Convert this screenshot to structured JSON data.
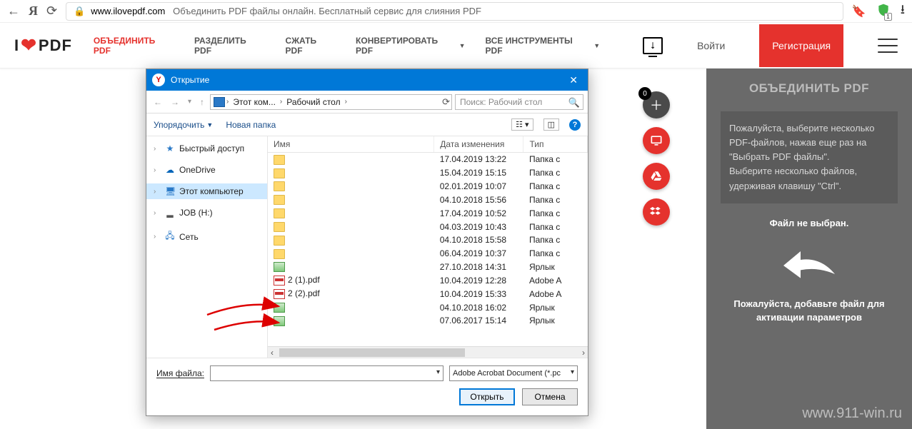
{
  "browser": {
    "url_host": "www.ilovepdf.com",
    "url_title": "Объединить PDF файлы онлайн. Бесплатный сервис для слияния PDF",
    "shield_badge": "1"
  },
  "site": {
    "logo_pre": "I",
    "logo_post": "PDF",
    "nav": {
      "merge": "ОБЪЕДИНИТЬ PDF",
      "split": "РАЗДЕЛИТЬ PDF",
      "compress": "СЖАТЬ PDF",
      "convert": "КОНВЕРТИРОВАТЬ PDF",
      "all": "ВСЕ ИНСТРУМЕНТЫ PDF"
    },
    "login": "Войти",
    "register": "Регистрация"
  },
  "panel": {
    "title": "ОБЪЕДИНИТЬ PDF",
    "help_l1": "Пожалуйста, выберите несколько PDF-файлов, нажав еще раз на \"Выбрать PDF файлы\".",
    "help_l2": "Выберите несколько файлов, удерживая клавишу \"Ctrl\".",
    "status": "Файл не выбран.",
    "msg": "Пожалуйста, добавьте файл для активации параметров",
    "watermark": "www.911-win.ru"
  },
  "bubbles": {
    "count": "0"
  },
  "dialog": {
    "title": "Открытие",
    "path": {
      "pc": "Этот ком...",
      "desk": "Рабочий стол"
    },
    "search_placeholder": "Поиск: Рабочий стол",
    "toolbar": {
      "organize": "Упорядочить",
      "newfolder": "Новая папка"
    },
    "columns": {
      "name": "Имя",
      "date": "Дата изменения",
      "type": "Тип"
    },
    "tree": {
      "quick": "Быстрый доступ",
      "onedrive": "OneDrive",
      "thispc": "Этот компьютер",
      "job": "JOB (H:)",
      "network": "Сеть"
    },
    "rows": [
      {
        "icon": "folder",
        "name": "",
        "date": "17.04.2019 13:22",
        "type": "Папка с"
      },
      {
        "icon": "folder",
        "name": "",
        "date": "15.04.2019 15:15",
        "type": "Папка с"
      },
      {
        "icon": "folder",
        "name": "",
        "date": "02.01.2019 10:07",
        "type": "Папка с"
      },
      {
        "icon": "folder",
        "name": "",
        "date": "04.10.2018 15:56",
        "type": "Папка с"
      },
      {
        "icon": "folder",
        "name": "",
        "date": "17.04.2019 10:52",
        "type": "Папка с"
      },
      {
        "icon": "folder",
        "name": "",
        "date": "04.03.2019 10:43",
        "type": "Папка с"
      },
      {
        "icon": "folder",
        "name": "",
        "date": "04.10.2018 15:58",
        "type": "Папка с"
      },
      {
        "icon": "folder",
        "name": "",
        "date": "06.04.2019 10:37",
        "type": "Папка с"
      },
      {
        "icon": "shortcut",
        "name": "",
        "date": "27.10.2018 14:31",
        "type": "Ярлык"
      },
      {
        "icon": "pdf",
        "name": "2 (1).pdf",
        "date": "10.04.2019 12:28",
        "type": "Adobe A"
      },
      {
        "icon": "pdf",
        "name": "2 (2).pdf",
        "date": "10.04.2019 15:33",
        "type": "Adobe A"
      },
      {
        "icon": "shortcut",
        "name": "",
        "date": "04.10.2018 16:02",
        "type": "Ярлык"
      },
      {
        "icon": "shortcut",
        "name": "",
        "date": "07.06.2017 15:14",
        "type": "Ярлык"
      }
    ],
    "footer": {
      "filename_label": "Имя файла:",
      "filetype": "Adobe Acrobat Document (*.pc",
      "open": "Открыть",
      "cancel": "Отмена"
    }
  }
}
